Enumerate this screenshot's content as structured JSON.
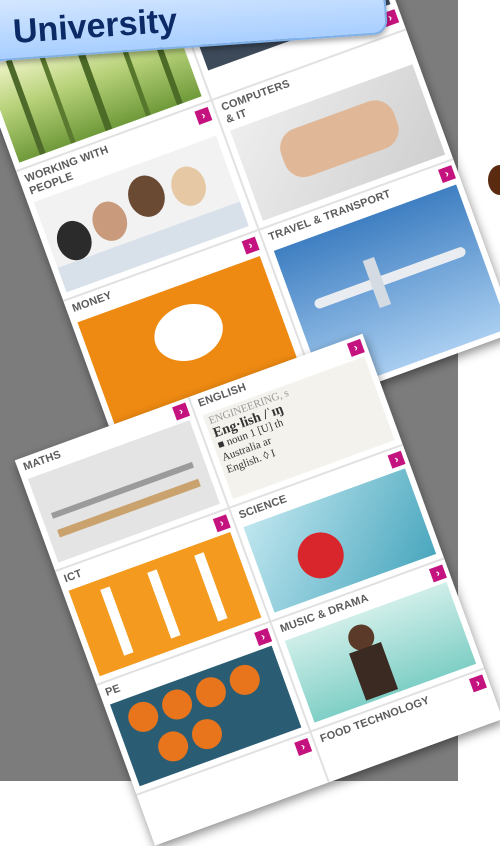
{
  "header": {
    "title": "University"
  },
  "tiles_top": [
    {
      "label": "",
      "icon": "arrow-right-icon"
    },
    {
      "label": "",
      "icon": "arrow-right-icon"
    },
    {
      "label": "WORKING WITH\nPEOPLE",
      "icon": "arrow-right-icon"
    },
    {
      "label": "COMPUTERS\n& IT",
      "icon": "arrow-right-icon"
    },
    {
      "label": "MONEY",
      "icon": "arrow-right-icon"
    },
    {
      "label": "TRAVEL & TRANSPORT",
      "icon": "arrow-right-icon"
    }
  ],
  "tiles_bottom": [
    {
      "label": "MATHS",
      "icon": "arrow-right-icon"
    },
    {
      "label": "ENGLISH",
      "icon": "arrow-right-icon",
      "image_text": [
        "ENGINEERING, s",
        "Eng·lish /ˈɪŋ",
        "■ noun 1 [U] th",
        "Australia ar",
        "English. ◊ I"
      ]
    },
    {
      "label": "ICT",
      "icon": "arrow-right-icon"
    },
    {
      "label": "SCIENCE",
      "icon": "arrow-right-icon"
    },
    {
      "label": "PE",
      "icon": "arrow-right-icon"
    },
    {
      "label": "MUSIC & DRAMA",
      "icon": "arrow-right-icon"
    },
    {
      "label": "FOOD TECHNOLOGY",
      "icon": "arrow-right-icon"
    }
  ],
  "colors": {
    "accent": "#c4137e",
    "background": "#7c7c7c",
    "title": "#0c2b66"
  }
}
